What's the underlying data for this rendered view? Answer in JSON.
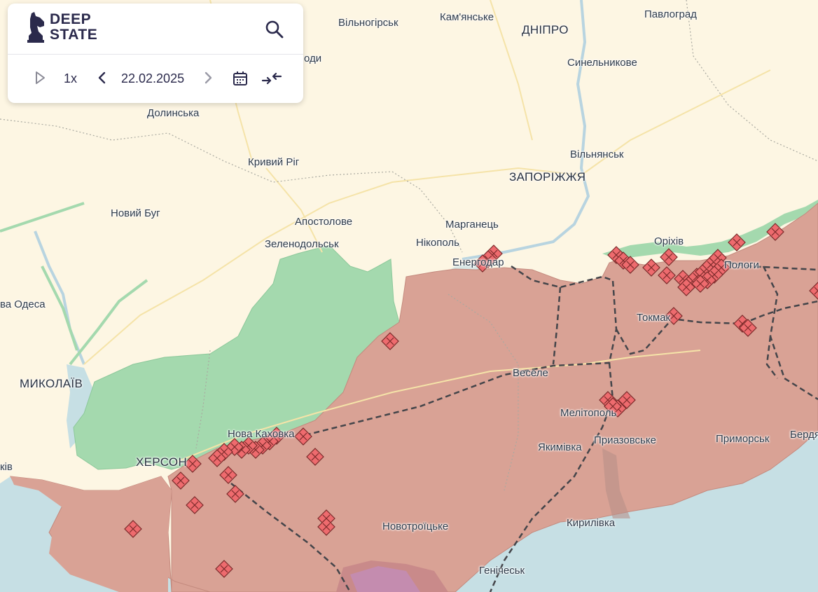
{
  "app": {
    "logo_line1": "DEEP",
    "logo_line2": "STATE",
    "logo_icon": "knight-chess-icon"
  },
  "toolbar": {
    "play_icon": "play-icon",
    "speed": "1x",
    "date": "22.02.2025",
    "prev_icon": "chevron-left-icon",
    "next_icon": "chevron-right-icon",
    "calendar_icon": "calendar-icon",
    "compare_icon": "compare-arrows-icon",
    "search_icon": "search-icon"
  },
  "colors": {
    "background": "#fdf6e3",
    "occupied": "#d9a295",
    "liberated": "#a4d9ae",
    "sea": "#c6dfe4",
    "crimea": "#c98a8a",
    "marker": "#ee6b6e",
    "front": "#44454a",
    "accent": "#2b2a4c"
  },
  "cities": [
    {
      "name": "Вільногірськ"
    },
    {
      "name": "Кам'янське"
    },
    {
      "name": "ДНІПРО"
    },
    {
      "name": "Павлоград"
    },
    {
      "name": "Синельникове"
    },
    {
      "name": "оди"
    },
    {
      "name": "Долинська"
    },
    {
      "name": "Кривий Ріг"
    },
    {
      "name": "Вільнянськ"
    },
    {
      "name": "ЗАПОРІЖЖЯ"
    },
    {
      "name": "Новий Буг"
    },
    {
      "name": "Апостолове"
    },
    {
      "name": "Марганець"
    },
    {
      "name": "Зеленодольськ"
    },
    {
      "name": "Нікополь"
    },
    {
      "name": "Енергодар"
    },
    {
      "name": "Оріхів"
    },
    {
      "name": "Пологи"
    },
    {
      "name": "ва Одеса"
    },
    {
      "name": "Токмак"
    },
    {
      "name": "МИКОЛАЇВ"
    },
    {
      "name": "Веселе"
    },
    {
      "name": "Мелітополь"
    },
    {
      "name": "Нова Каховка"
    },
    {
      "name": "Якимівка"
    },
    {
      "name": "Приазовське"
    },
    {
      "name": "Приморськ"
    },
    {
      "name": "Бердя"
    },
    {
      "name": "ХЕРСОН"
    },
    {
      "name": "ків"
    },
    {
      "name": "Новотроїцьке"
    },
    {
      "name": "Кирилівка"
    },
    {
      "name": "Генічеськ"
    }
  ]
}
